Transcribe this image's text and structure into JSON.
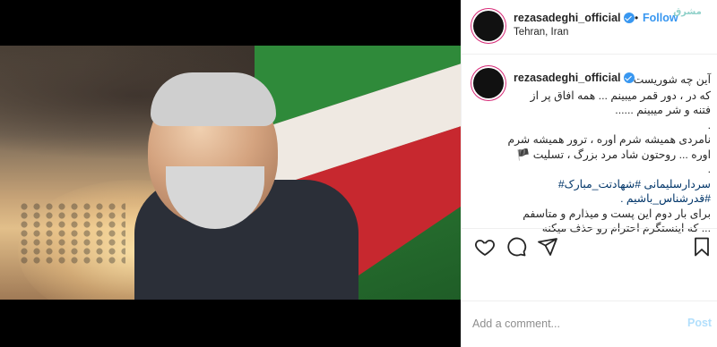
{
  "header": {
    "username": "rezasadeghi_official",
    "separator": "•",
    "follow_label": "Follow",
    "location": "Tehran, Iran",
    "watermark": "مشرق"
  },
  "caption": {
    "username": "rezasadeghi_official",
    "lines": [
      "آین چه شوریست",
      "که در ، دور قمر میبینم ... همه افاق پر از",
      "فتنه و شر میبینم ......",
      ".",
      "نامردی همیشه شرم اوره ، ترور همیشه شرم",
      "اوره ... روحتون شاد مرد بزرگ ، تسلیت 🏴",
      ".",
      "سردارسلیمانی #شهادتت_مبارک#",
      "#قدرشناس_باشیم .",
      "برای بار دوم این پست و میذارم و متاسفم",
      "... که اینستگرم احترام رو حذف میکنه"
    ]
  },
  "actions": {
    "like_icon": "heart-icon",
    "comment_icon": "comment-icon",
    "share_icon": "share-icon",
    "save_icon": "bookmark-icon"
  },
  "comment": {
    "placeholder": "Add a comment...",
    "post_label": "Post"
  },
  "colors": {
    "link": "#3897f0",
    "post_disabled": "#b2dffc",
    "hashtag": "#003569"
  }
}
